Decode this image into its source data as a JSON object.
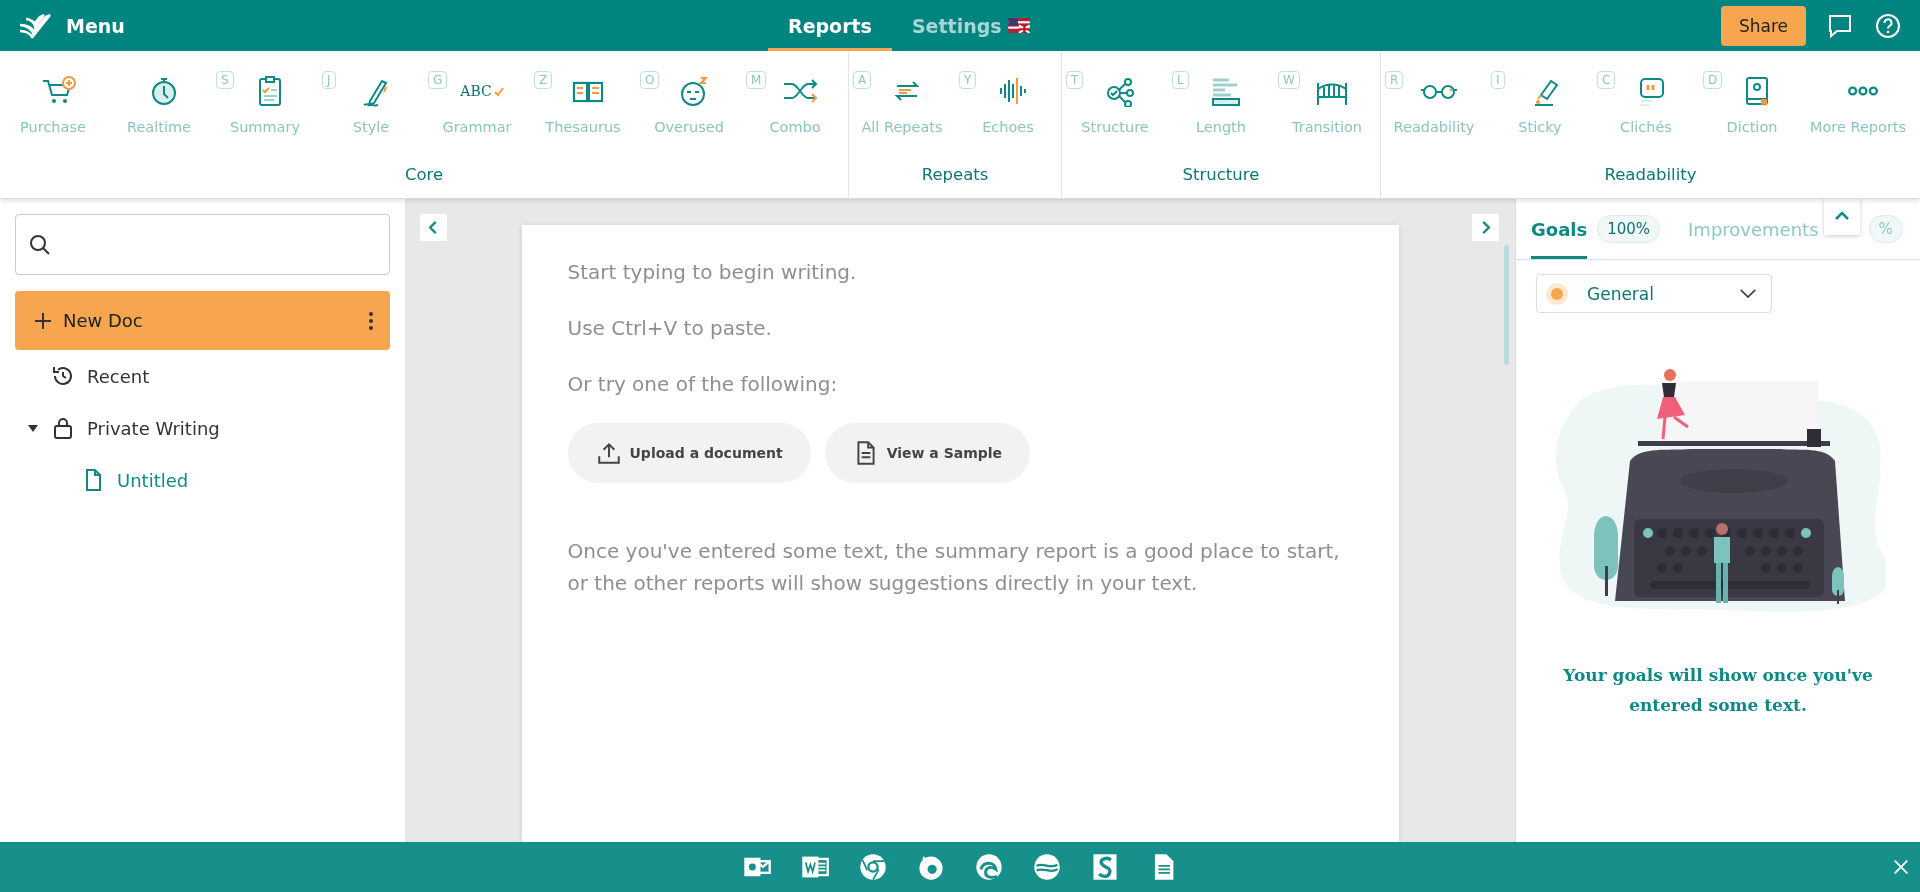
{
  "header": {
    "menu_label": "Menu",
    "share": "Share"
  },
  "nav_tabs": [
    {
      "label": "Reports",
      "selected": true
    },
    {
      "label": "Settings",
      "selected": false
    }
  ],
  "ribbon": [
    {
      "title": "Core",
      "items": [
        {
          "label": "Purchase"
        },
        {
          "label": "Realtime"
        },
        {
          "label": "Summary",
          "key": "S"
        },
        {
          "label": "Style",
          "key": "J"
        },
        {
          "label": "Grammar",
          "key": "G",
          "icon_text": "ABC"
        },
        {
          "label": "Thesaurus",
          "key": "Z"
        },
        {
          "label": "Overused",
          "key": "O"
        },
        {
          "label": "Combo",
          "key": "M"
        }
      ]
    },
    {
      "title": "Repeats",
      "items": [
        {
          "label": "All Repeats",
          "key": "A"
        },
        {
          "label": "Echoes",
          "key": "Y"
        }
      ]
    },
    {
      "title": "Structure",
      "items": [
        {
          "label": "Structure",
          "key": "T"
        },
        {
          "label": "Length",
          "key": "L"
        },
        {
          "label": "Transition",
          "key": "W"
        }
      ]
    },
    {
      "title": "Readability",
      "items": [
        {
          "label": "Readability",
          "key": "R"
        },
        {
          "label": "Sticky",
          "key": "I"
        },
        {
          "label": "Clichés",
          "key": "C"
        },
        {
          "label": "Diction",
          "key": "D"
        },
        {
          "label": "More Reports"
        }
      ]
    }
  ],
  "sidebar": {
    "new_doc": "New Doc",
    "tree": [
      {
        "label": "Recent",
        "kind": "recent",
        "selected": false
      },
      {
        "label": "Private Writing",
        "kind": "folder",
        "selected": false,
        "expanded": true,
        "children": [
          {
            "label": "Untitled",
            "kind": "doc",
            "selected": true
          }
        ]
      }
    ]
  },
  "document": {
    "lines": [
      "Start typing to begin writing.",
      "Use Ctrl+V to paste.",
      "Or try one of the following:"
    ],
    "buttons": [
      {
        "label": "Upload a document",
        "kind": "upload"
      },
      {
        "label": "View a Sample",
        "kind": "sample"
      }
    ],
    "hint": "Once you've entered some text, the summary report is a good place to start, or the other reports will show suggestions directly in your text."
  },
  "panel": {
    "tabs": [
      {
        "label": "Goals",
        "badge": "100%",
        "selected": true
      },
      {
        "label": "Improvements",
        "badge": "%",
        "selected": false
      }
    ],
    "dropdown": "General",
    "message": "Your goals will show once you've entered some text."
  }
}
